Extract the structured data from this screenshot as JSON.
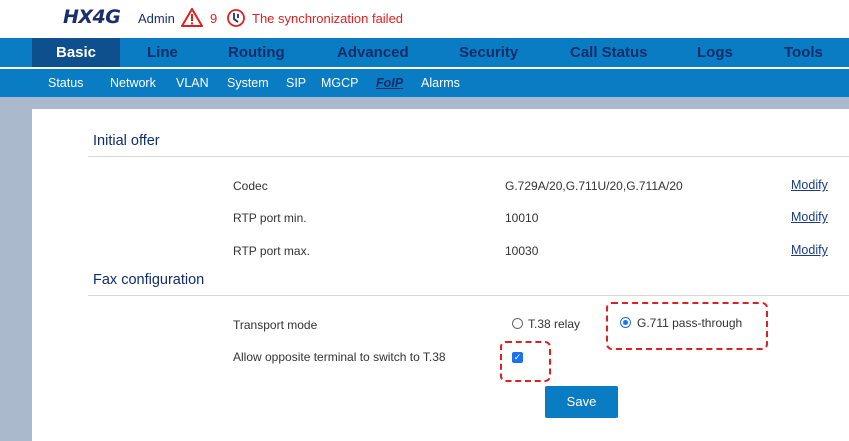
{
  "header": {
    "brand": "HX4G",
    "user": "Admin",
    "alarm_count": "9",
    "sync_status": "The synchronization failed"
  },
  "main_menu": [
    "Basic",
    "Line",
    "Routing",
    "Advanced",
    "Security",
    "Call Status",
    "Logs",
    "Tools"
  ],
  "main_menu_active": "Basic",
  "sub_menu": [
    "Status",
    "Network",
    "VLAN",
    "System",
    "SIP",
    "MGCP",
    "FoIP",
    "Alarms"
  ],
  "sub_menu_active": "FoIP",
  "initial_offer": {
    "title": "Initial offer",
    "rows": [
      {
        "label": "Codec",
        "value": "G.729A/20,G.711U/20,G.711A/20",
        "action": "Modify"
      },
      {
        "label": "RTP port min.",
        "value": "10010",
        "action": "Modify"
      },
      {
        "label": "RTP port max.",
        "value": "10030",
        "action": "Modify"
      }
    ]
  },
  "fax_config": {
    "title": "Fax configuration",
    "transport_mode_label": "Transport mode",
    "transport_options": [
      {
        "label": "T.38 relay",
        "checked": false
      },
      {
        "label": "G.711 pass-through",
        "checked": true
      }
    ],
    "allow_switch_label": "Allow opposite terminal to switch to T.38",
    "allow_switch_checked": true
  },
  "save_label": "Save",
  "colors": {
    "menu_bg": "#0a7cc4",
    "menu_active": "#0e4f8e",
    "menu_text": "#0f2d6b",
    "alert": "#e02020",
    "accent": "#1a73e8"
  }
}
